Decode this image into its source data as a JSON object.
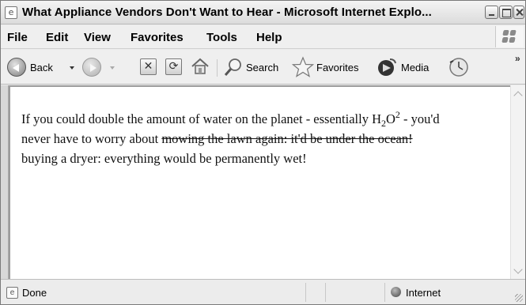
{
  "window": {
    "title": "What Appliance Vendors Don't Want to Hear - Microsoft Internet Explo..."
  },
  "menu": {
    "items": [
      "File",
      "Edit",
      "View",
      "Favorites",
      "Tools",
      "Help"
    ]
  },
  "toolbar": {
    "back_label": "Back",
    "search_label": "Search",
    "favorites_label": "Favorites",
    "media_label": "Media",
    "overflow": "»"
  },
  "page": {
    "line1_before": "If you could double the amount of water on the planet - essentially H",
    "formula_sub": "2",
    "formula_mid": "O",
    "formula_sup": "2",
    "line1_after": " - you'd",
    "line2_before": "never have to worry about ",
    "struck_text": "mowing the lawn again: it'd be under the ocean!",
    "line3": "buying a dryer: everything would be permanently wet!"
  },
  "status": {
    "text": "Done",
    "zone": "Internet"
  },
  "icons": {
    "title": "ie-page-icon",
    "back": "back-arrow-icon",
    "forward": "forward-arrow-icon",
    "stop": "stop-icon",
    "refresh": "refresh-icon",
    "home": "home-icon",
    "search": "search-icon",
    "favorites": "star-icon",
    "media": "media-icon",
    "history": "history-icon",
    "zone": "globe-icon"
  }
}
